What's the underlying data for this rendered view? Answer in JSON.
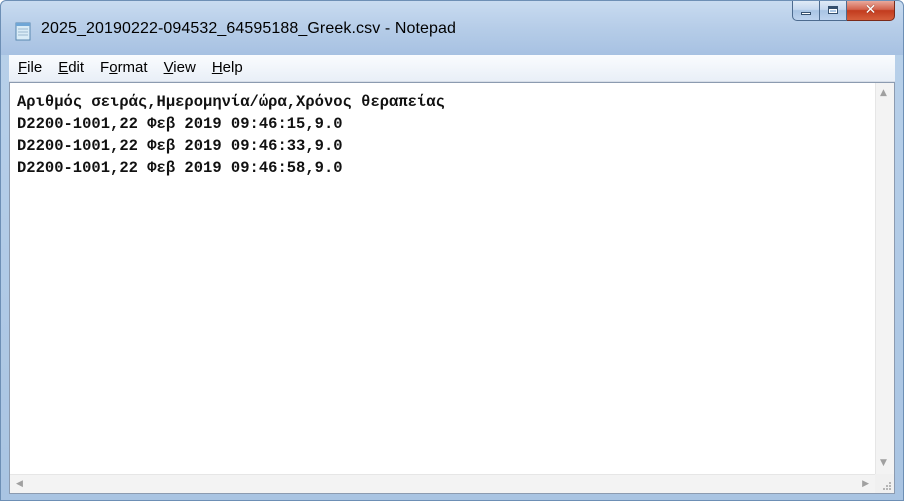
{
  "window": {
    "title": "2025_20190222-094532_64595188_Greek.csv - Notepad",
    "icons": {
      "app": "notepad-icon",
      "minimize": "minimize-icon",
      "maximize": "maximize-icon",
      "close": "close-icon"
    }
  },
  "menu": {
    "items": [
      {
        "accel": "F",
        "rest": "ile"
      },
      {
        "accel": "E",
        "rest": "dit"
      },
      {
        "pre": "F",
        "accel": "o",
        "rest": "rmat"
      },
      {
        "accel": "V",
        "rest": "iew"
      },
      {
        "accel": "H",
        "rest": "elp"
      }
    ]
  },
  "document": {
    "lines": [
      "Αριθμός σειράς,Ημερομηνία/ώρα,Χρόνος θεραπείας",
      "D2200-1001,22 Φεβ 2019 09:46:15,9.0",
      "D2200-1001,22 Φεβ 2019 09:46:33,9.0",
      "D2200-1001,22 Φεβ 2019 09:46:58,9.0"
    ]
  },
  "colors": {
    "title_bar": "#b6cde8",
    "close_button": "#c23b1e",
    "editor_bg": "#ffffff"
  }
}
